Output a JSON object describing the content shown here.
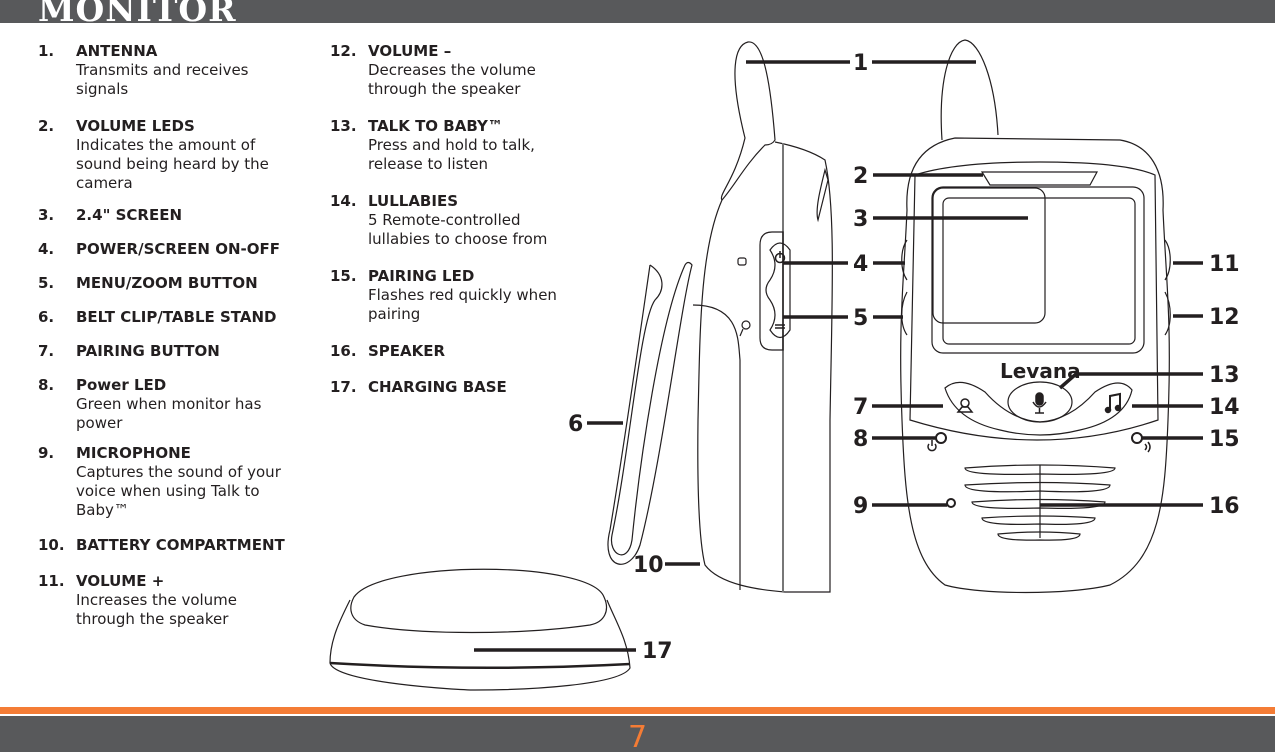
{
  "header": {
    "title": "MONITOR"
  },
  "footer": {
    "page_number": "7"
  },
  "colors": {
    "header_bg": "#58595b",
    "accent": "#f47c35",
    "text": "#231f20"
  },
  "legend": {
    "column1": [
      {
        "num": "1.",
        "title": "ANTENNA",
        "desc": "Transmits and receives signals"
      },
      {
        "num": "2.",
        "title": "VOLUME LEDS",
        "desc": "Indicates the amount of sound being heard by the camera"
      },
      {
        "num": "3.",
        "title": "2.4\" SCREEN",
        "desc": ""
      },
      {
        "num": "4.",
        "title": "POWER/SCREEN ON-OFF",
        "desc": ""
      },
      {
        "num": "5.",
        "title": "MENU/ZOOM BUTTON",
        "desc": ""
      },
      {
        "num": "6.",
        "title": "BELT CLIP/TABLE STAND",
        "desc": ""
      },
      {
        "num": "7.",
        "title": "PAIRING BUTTON",
        "desc": ""
      },
      {
        "num": "8.",
        "title": "Power LED",
        "desc": "Green when monitor has power"
      },
      {
        "num": "9.",
        "title": "MICROPHONE",
        "desc": "Captures the sound of your voice when using Talk to Baby™"
      },
      {
        "num": "10.",
        "title": "BATTERY COMPARTMENT",
        "desc": ""
      },
      {
        "num": "11.",
        "title": "VOLUME +",
        "desc": "Increases the volume through the speaker"
      }
    ],
    "column2": [
      {
        "num": "12.",
        "title": "VOLUME –",
        "desc": "Decreases the volume through the speaker"
      },
      {
        "num": "13.",
        "title": "TALK TO BABY™",
        "desc": "Press and hold to talk, release to listen"
      },
      {
        "num": "14.",
        "title": "LULLABIES",
        "desc": "5 Remote-controlled lullabies to choose from"
      },
      {
        "num": "15.",
        "title": "PAIRING LED",
        "desc": "Flashes red quickly when pairing"
      },
      {
        "num": "16.",
        "title": "SPEAKER",
        "desc": ""
      },
      {
        "num": "17.",
        "title": "CHARGING BASE",
        "desc": ""
      }
    ]
  },
  "diagram": {
    "brand_logo": "Levana",
    "callouts": [
      "1",
      "2",
      "3",
      "4",
      "5",
      "6",
      "7",
      "8",
      "9",
      "10",
      "11",
      "12",
      "13",
      "14",
      "15",
      "16",
      "17"
    ]
  }
}
